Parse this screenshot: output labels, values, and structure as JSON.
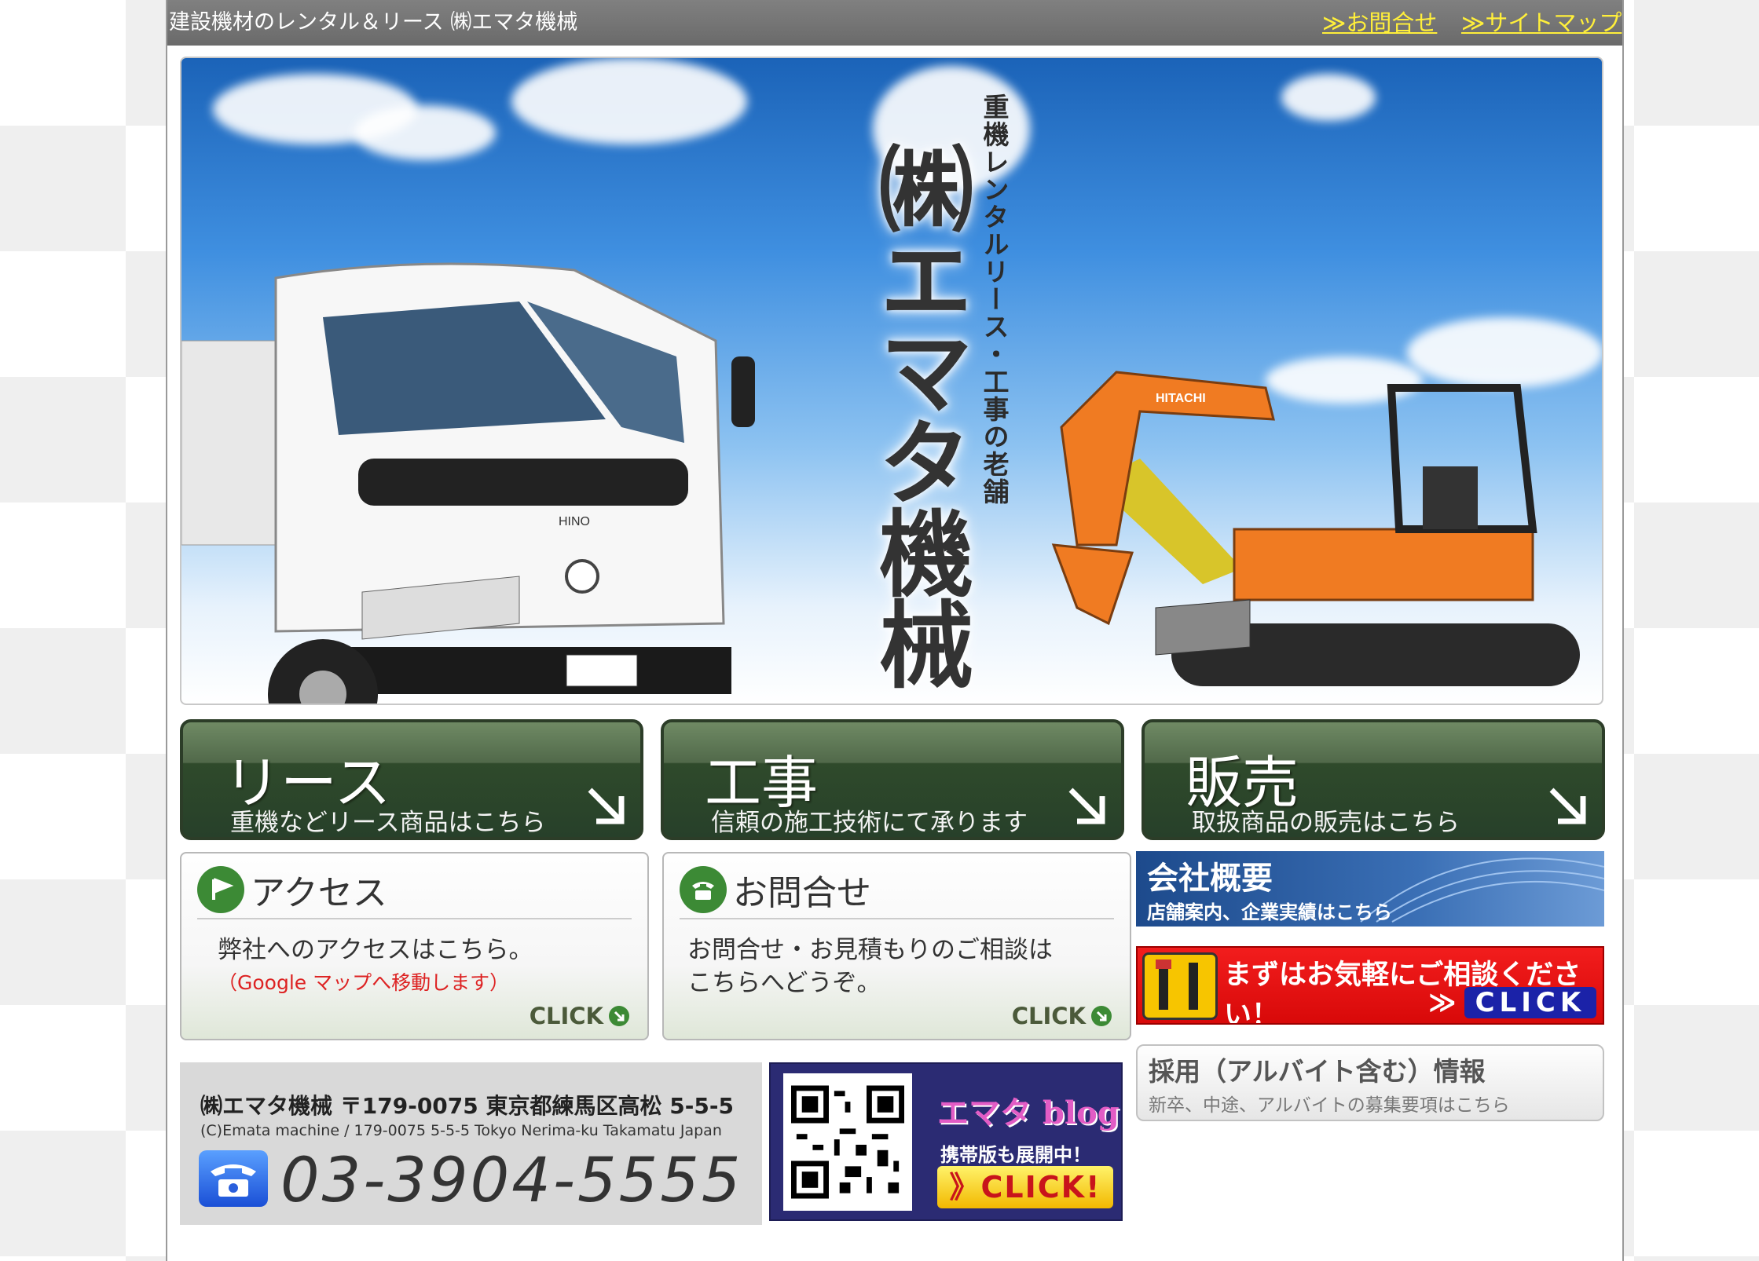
{
  "topbar": {
    "site_desc": "建設機材のレンタル＆リース ㈱エマタ機械",
    "contact_link": "≫お問合せ",
    "sitemap_link": "≫サイトマップ"
  },
  "hero": {
    "tagline": "重機レンタルリース・工事の老舗",
    "company": "㈱エマタ機械",
    "truck_brand": "HINO",
    "excavator_brand": "HITACHI"
  },
  "categories": [
    {
      "title": "リース",
      "sub": "重機などリース商品はこちら"
    },
    {
      "title": "工事",
      "sub": "信頼の施工技術にて承ります"
    },
    {
      "title": "販売",
      "sub": "取扱商品の販売はこちら"
    }
  ],
  "access": {
    "title": "アクセス",
    "body": "弊社へのアクセスはこちら。",
    "note": "（Google マップへ移動します）",
    "click": "CLICK"
  },
  "contact": {
    "title": "お問合せ",
    "body_line1": "お問合せ・お見積もりのご相談は",
    "body_line2": "こちらへどうぞ。",
    "click": "CLICK"
  },
  "company_banner": {
    "title": "会社概要",
    "sub": "店舗案内、企業実績はこちら"
  },
  "consult_banner": {
    "title": "まずはお気軽にご相談ください！",
    "arrows": "≫",
    "click": "CLICK"
  },
  "recruit_banner": {
    "title": "採用（アルバイト含む）情報",
    "sub": "新卒、中途、アルバイトの募集要項はこちら"
  },
  "address": {
    "line1": "㈱エマタ機械 〒179-0075 東京都練馬区高松 5-5-5",
    "line2": "(C)Emata machine / 179-0075 5-5-5 Tokyo Nerima-ku Takamatu Japan",
    "tel": "03-3904-5555"
  },
  "blog": {
    "title": "エマタ blog",
    "sub": "携帯版も展開中！",
    "click": "》CLICK!"
  },
  "colors": {
    "accent_green": "#2f4a2b",
    "link_yellow": "#ffef3a",
    "consult_red": "#e00d0d",
    "company_blue": "#2a5ea4"
  }
}
